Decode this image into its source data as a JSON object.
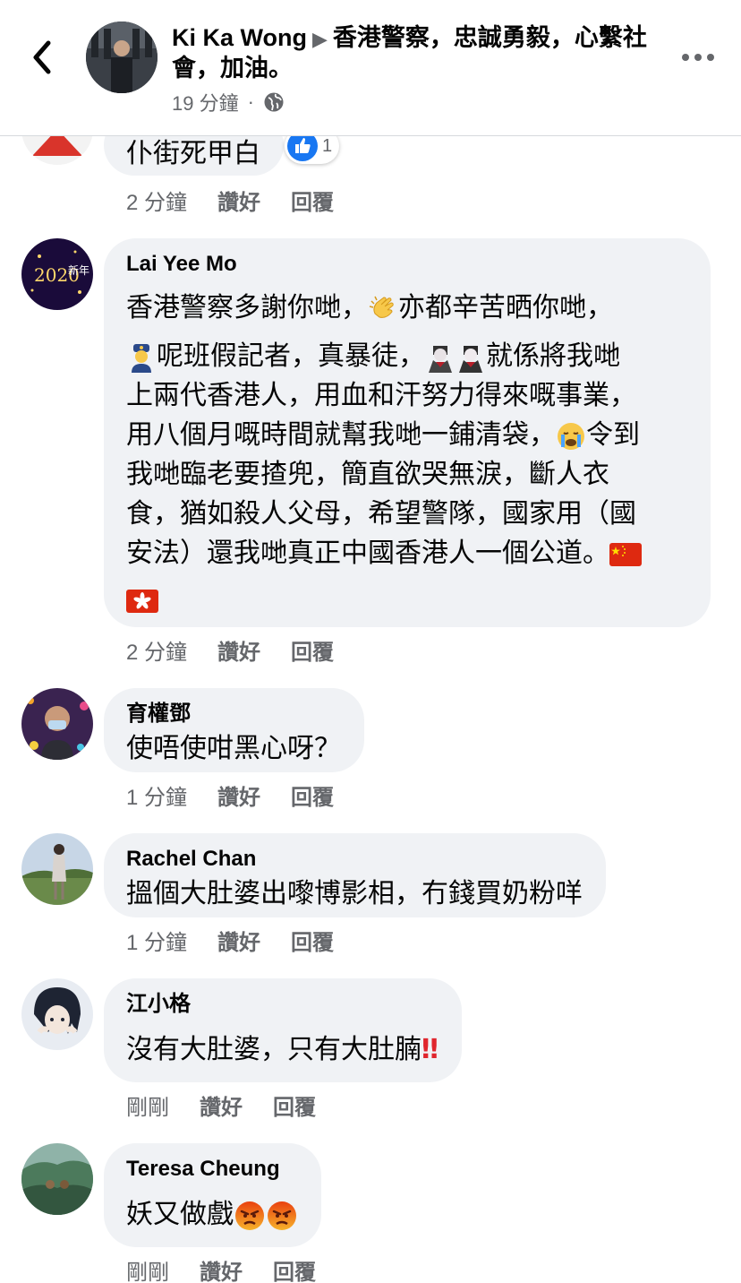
{
  "header": {
    "author": "Ki Ka Wong",
    "arrow": "▶",
    "title": "香港警察，忠誠勇毅，心繫社會，加油。",
    "time": "19 分鐘",
    "dot": "·",
    "privacy_icon": "globe-icon"
  },
  "actions": {
    "like": "讚好",
    "reply": "回覆"
  },
  "comments": [
    {
      "author": "",
      "text": "仆街死甲白",
      "time": "2 分鐘",
      "like_count": "1"
    },
    {
      "author": "Lai Yee  Mo",
      "line1": "香港警察多謝你哋，",
      "line1b": "亦都辛苦晒你哋，",
      "line2": "呢班假記者，真暴徒，",
      "line2b": "就係將我哋",
      "line3": "上兩代香港人，用血和汗努力得來嘅事業，",
      "line4": "用八個月嘅時間就幫我哋一鋪清袋，",
      "line4b": "令到",
      "line5": "我哋臨老要揸兜，簡直欲哭無淚，斷人衣",
      "line6": "食，猶如殺人父母，希望警隊，國家用（國",
      "line7": "安法）還我哋真正中國香港人一個公道。",
      "time": "2 分鐘"
    },
    {
      "author": "育權鄧",
      "text": "使唔使咁黑心呀？",
      "time": "1 分鐘"
    },
    {
      "author": "Rachel Chan",
      "text": "搵個大肚婆出嚟博影相，冇錢買奶粉咩",
      "time": "1 分鐘"
    },
    {
      "author": "江小格",
      "text": "沒有大肚婆，只有大肚腩",
      "emoji": "‼",
      "time": "剛剛"
    },
    {
      "author": "Teresa Cheung",
      "text": "妖又做戲",
      "time": "剛剛"
    }
  ],
  "colors": {
    "bubble": "#f0f2f5",
    "meta": "#65676b",
    "like_blue": "#1877f2",
    "angry": "#e9710f"
  }
}
